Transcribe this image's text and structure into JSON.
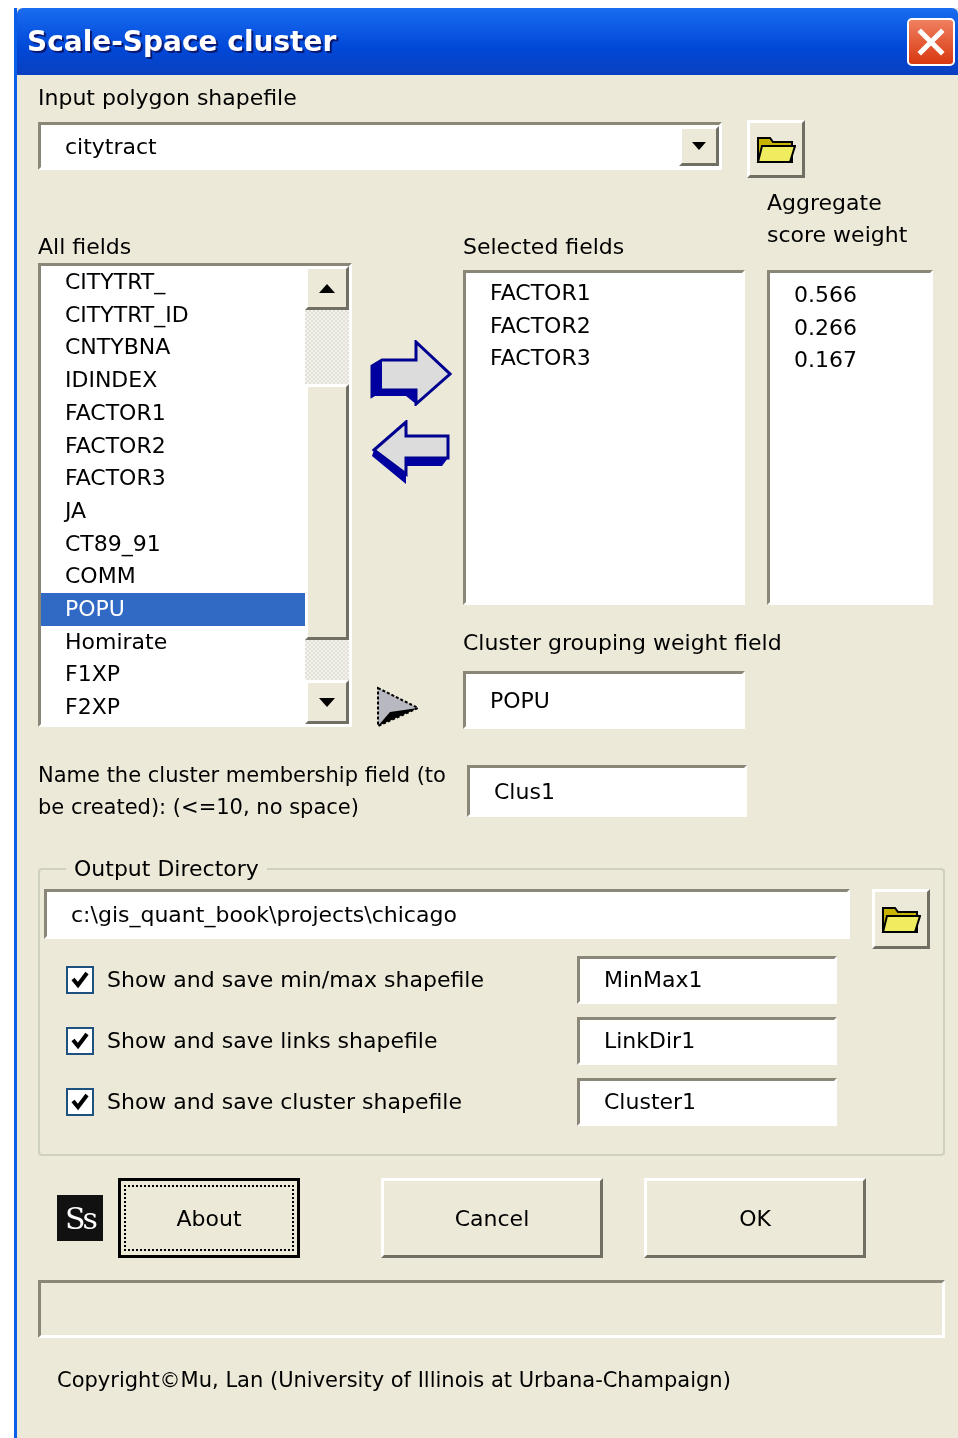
{
  "window": {
    "title": "Scale-Space cluster"
  },
  "input": {
    "label": "Input polygon shapefile",
    "value": "citytract"
  },
  "all_fields": {
    "label": "All fields",
    "items": [
      {
        "name": "CITYTRT_",
        "selected": false
      },
      {
        "name": "CITYTRT_ID",
        "selected": false
      },
      {
        "name": "CNTYBNA",
        "selected": false
      },
      {
        "name": "IDINDEX",
        "selected": false
      },
      {
        "name": "FACTOR1",
        "selected": false
      },
      {
        "name": "FACTOR2",
        "selected": false
      },
      {
        "name": "FACTOR3",
        "selected": false
      },
      {
        "name": "JA",
        "selected": false
      },
      {
        "name": "CT89_91",
        "selected": false
      },
      {
        "name": "COMM",
        "selected": false
      },
      {
        "name": "POPU",
        "selected": true
      },
      {
        "name": "Homirate",
        "selected": false
      },
      {
        "name": "F1XP",
        "selected": false
      },
      {
        "name": "F2XP",
        "selected": false
      }
    ]
  },
  "selected_fields": {
    "label": "Selected fields",
    "items": [
      "FACTOR1",
      "FACTOR2",
      "FACTOR3"
    ]
  },
  "weights": {
    "label": "Aggregate score weight",
    "items": [
      "0.566",
      "0.266",
      "0.167"
    ]
  },
  "grouping": {
    "label": "Cluster grouping weight field",
    "value": "POPU"
  },
  "membership": {
    "label": "Name the cluster membership field (to be created): (<=10, no space)",
    "value": "Clus1"
  },
  "output": {
    "legend": "Output Directory",
    "path": "c:\\gis_quant_book\\projects\\chicago",
    "options": [
      {
        "label": "Show and save min/max shapefile",
        "checked": true,
        "value": "MinMax1"
      },
      {
        "label": "Show and save links shapefile",
        "checked": true,
        "value": "LinkDir1"
      },
      {
        "label": "Show and save cluster shapefile",
        "checked": true,
        "value": "Cluster1"
      }
    ]
  },
  "logo": "Ss",
  "buttons": [
    {
      "label": "About",
      "focused": true
    },
    {
      "label": "Cancel",
      "focused": false
    },
    {
      "label": "OK",
      "focused": false
    }
  ],
  "copyright": "Copyright©Mu, Lan (University of Illinois at Urbana-Champaign)"
}
